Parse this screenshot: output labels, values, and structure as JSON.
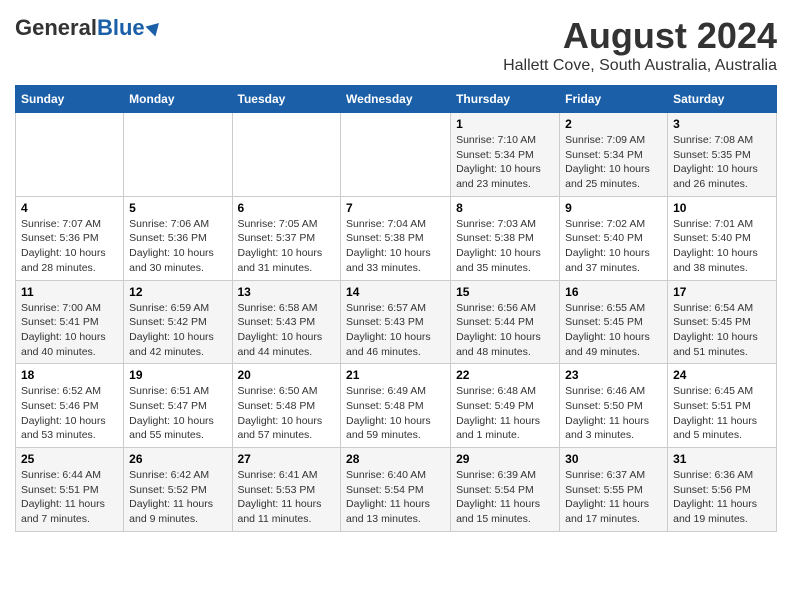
{
  "header": {
    "logo_general": "General",
    "logo_blue": "Blue",
    "main_title": "August 2024",
    "subtitle": "Hallett Cove, South Australia, Australia"
  },
  "days_of_week": [
    "Sunday",
    "Monday",
    "Tuesday",
    "Wednesday",
    "Thursday",
    "Friday",
    "Saturday"
  ],
  "weeks": [
    [
      {
        "day": "",
        "info": ""
      },
      {
        "day": "",
        "info": ""
      },
      {
        "day": "",
        "info": ""
      },
      {
        "day": "",
        "info": ""
      },
      {
        "day": "1",
        "info": "Sunrise: 7:10 AM\nSunset: 5:34 PM\nDaylight: 10 hours\nand 23 minutes."
      },
      {
        "day": "2",
        "info": "Sunrise: 7:09 AM\nSunset: 5:34 PM\nDaylight: 10 hours\nand 25 minutes."
      },
      {
        "day": "3",
        "info": "Sunrise: 7:08 AM\nSunset: 5:35 PM\nDaylight: 10 hours\nand 26 minutes."
      }
    ],
    [
      {
        "day": "4",
        "info": "Sunrise: 7:07 AM\nSunset: 5:36 PM\nDaylight: 10 hours\nand 28 minutes."
      },
      {
        "day": "5",
        "info": "Sunrise: 7:06 AM\nSunset: 5:36 PM\nDaylight: 10 hours\nand 30 minutes."
      },
      {
        "day": "6",
        "info": "Sunrise: 7:05 AM\nSunset: 5:37 PM\nDaylight: 10 hours\nand 31 minutes."
      },
      {
        "day": "7",
        "info": "Sunrise: 7:04 AM\nSunset: 5:38 PM\nDaylight: 10 hours\nand 33 minutes."
      },
      {
        "day": "8",
        "info": "Sunrise: 7:03 AM\nSunset: 5:38 PM\nDaylight: 10 hours\nand 35 minutes."
      },
      {
        "day": "9",
        "info": "Sunrise: 7:02 AM\nSunset: 5:40 PM\nDaylight: 10 hours\nand 37 minutes."
      },
      {
        "day": "10",
        "info": "Sunrise: 7:01 AM\nSunset: 5:40 PM\nDaylight: 10 hours\nand 38 minutes."
      }
    ],
    [
      {
        "day": "11",
        "info": "Sunrise: 7:00 AM\nSunset: 5:41 PM\nDaylight: 10 hours\nand 40 minutes."
      },
      {
        "day": "12",
        "info": "Sunrise: 6:59 AM\nSunset: 5:42 PM\nDaylight: 10 hours\nand 42 minutes."
      },
      {
        "day": "13",
        "info": "Sunrise: 6:58 AM\nSunset: 5:43 PM\nDaylight: 10 hours\nand 44 minutes."
      },
      {
        "day": "14",
        "info": "Sunrise: 6:57 AM\nSunset: 5:43 PM\nDaylight: 10 hours\nand 46 minutes."
      },
      {
        "day": "15",
        "info": "Sunrise: 6:56 AM\nSunset: 5:44 PM\nDaylight: 10 hours\nand 48 minutes."
      },
      {
        "day": "16",
        "info": "Sunrise: 6:55 AM\nSunset: 5:45 PM\nDaylight: 10 hours\nand 49 minutes."
      },
      {
        "day": "17",
        "info": "Sunrise: 6:54 AM\nSunset: 5:45 PM\nDaylight: 10 hours\nand 51 minutes."
      }
    ],
    [
      {
        "day": "18",
        "info": "Sunrise: 6:52 AM\nSunset: 5:46 PM\nDaylight: 10 hours\nand 53 minutes."
      },
      {
        "day": "19",
        "info": "Sunrise: 6:51 AM\nSunset: 5:47 PM\nDaylight: 10 hours\nand 55 minutes."
      },
      {
        "day": "20",
        "info": "Sunrise: 6:50 AM\nSunset: 5:48 PM\nDaylight: 10 hours\nand 57 minutes."
      },
      {
        "day": "21",
        "info": "Sunrise: 6:49 AM\nSunset: 5:48 PM\nDaylight: 10 hours\nand 59 minutes."
      },
      {
        "day": "22",
        "info": "Sunrise: 6:48 AM\nSunset: 5:49 PM\nDaylight: 11 hours\nand 1 minute."
      },
      {
        "day": "23",
        "info": "Sunrise: 6:46 AM\nSunset: 5:50 PM\nDaylight: 11 hours\nand 3 minutes."
      },
      {
        "day": "24",
        "info": "Sunrise: 6:45 AM\nSunset: 5:51 PM\nDaylight: 11 hours\nand 5 minutes."
      }
    ],
    [
      {
        "day": "25",
        "info": "Sunrise: 6:44 AM\nSunset: 5:51 PM\nDaylight: 11 hours\nand 7 minutes."
      },
      {
        "day": "26",
        "info": "Sunrise: 6:42 AM\nSunset: 5:52 PM\nDaylight: 11 hours\nand 9 minutes."
      },
      {
        "day": "27",
        "info": "Sunrise: 6:41 AM\nSunset: 5:53 PM\nDaylight: 11 hours\nand 11 minutes."
      },
      {
        "day": "28",
        "info": "Sunrise: 6:40 AM\nSunset: 5:54 PM\nDaylight: 11 hours\nand 13 minutes."
      },
      {
        "day": "29",
        "info": "Sunrise: 6:39 AM\nSunset: 5:54 PM\nDaylight: 11 hours\nand 15 minutes."
      },
      {
        "day": "30",
        "info": "Sunrise: 6:37 AM\nSunset: 5:55 PM\nDaylight: 11 hours\nand 17 minutes."
      },
      {
        "day": "31",
        "info": "Sunrise: 6:36 AM\nSunset: 5:56 PM\nDaylight: 11 hours\nand 19 minutes."
      }
    ]
  ]
}
